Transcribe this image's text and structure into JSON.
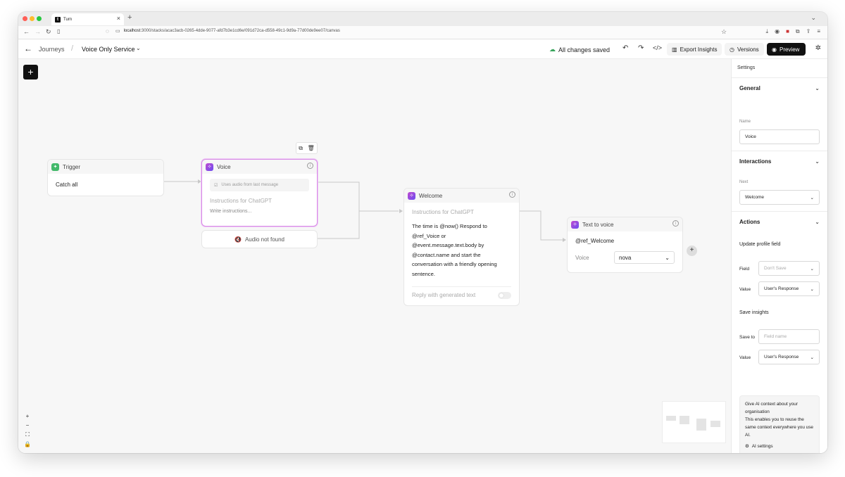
{
  "browser": {
    "tab_title": "Turn",
    "url_host": "localhost",
    "url_path": ":3000/stacks/acac3acb-0265-4dde-9077-afd7b3e1cd6e/091d72ca-d558-49c1-9d9a-77d00de9ee07/canvas"
  },
  "header": {
    "breadcrumb_parent": "Journeys",
    "breadcrumb_current": "Voice Only Service",
    "save_status": "All changes saved",
    "export_label": "Export Insights",
    "versions_label": "Versions",
    "preview_label": "Preview"
  },
  "nodes": {
    "trigger": {
      "title": "Trigger",
      "body": "Catch all"
    },
    "voice": {
      "title": "Voice",
      "audio_hint": "Uses audio from last message",
      "instructions_label": "Instructions for ChatGPT",
      "instructions_placeholder": "Write instructions..."
    },
    "audio_not_found": {
      "label": "Audio not found"
    },
    "welcome": {
      "title": "Welcome",
      "instructions_label": "Instructions for ChatGPT",
      "body": "The time is @now() Respond to @ref_Voice or @event.message.text.body by @contact.name and start the conversation with a friendly opening sentence.",
      "reply_label": "Reply with generated text"
    },
    "tts": {
      "title": "Text to voice",
      "ref": "@ref_Welcome",
      "voice_label": "Voice",
      "voice_value": "nova"
    }
  },
  "settings": {
    "title": "Settings",
    "general": {
      "header": "General",
      "name_label": "Name",
      "name_value": "Voice"
    },
    "interactions": {
      "header": "Interactions",
      "next_label": "Next",
      "next_value": "Welcome"
    },
    "actions": {
      "header": "Actions",
      "update_profile_label": "Update profile field",
      "field_label": "Field",
      "field_placeholder": "Don't Save",
      "value_label": "Value",
      "value_value": "User's Response",
      "save_insights_label": "Save insights",
      "save_to_label": "Save to",
      "save_to_placeholder": "Field name",
      "value2_label": "Value",
      "value2_value": "User's Response"
    },
    "ai_card": {
      "title": "Give AI context about your organisation",
      "body": "This enables you to reuse the same context everywhere you use AI.",
      "button": "AI settings"
    }
  },
  "colors": {
    "accent_purple": "#c04bd0",
    "trigger_green": "#43b96b",
    "preview_button": "#111111"
  }
}
